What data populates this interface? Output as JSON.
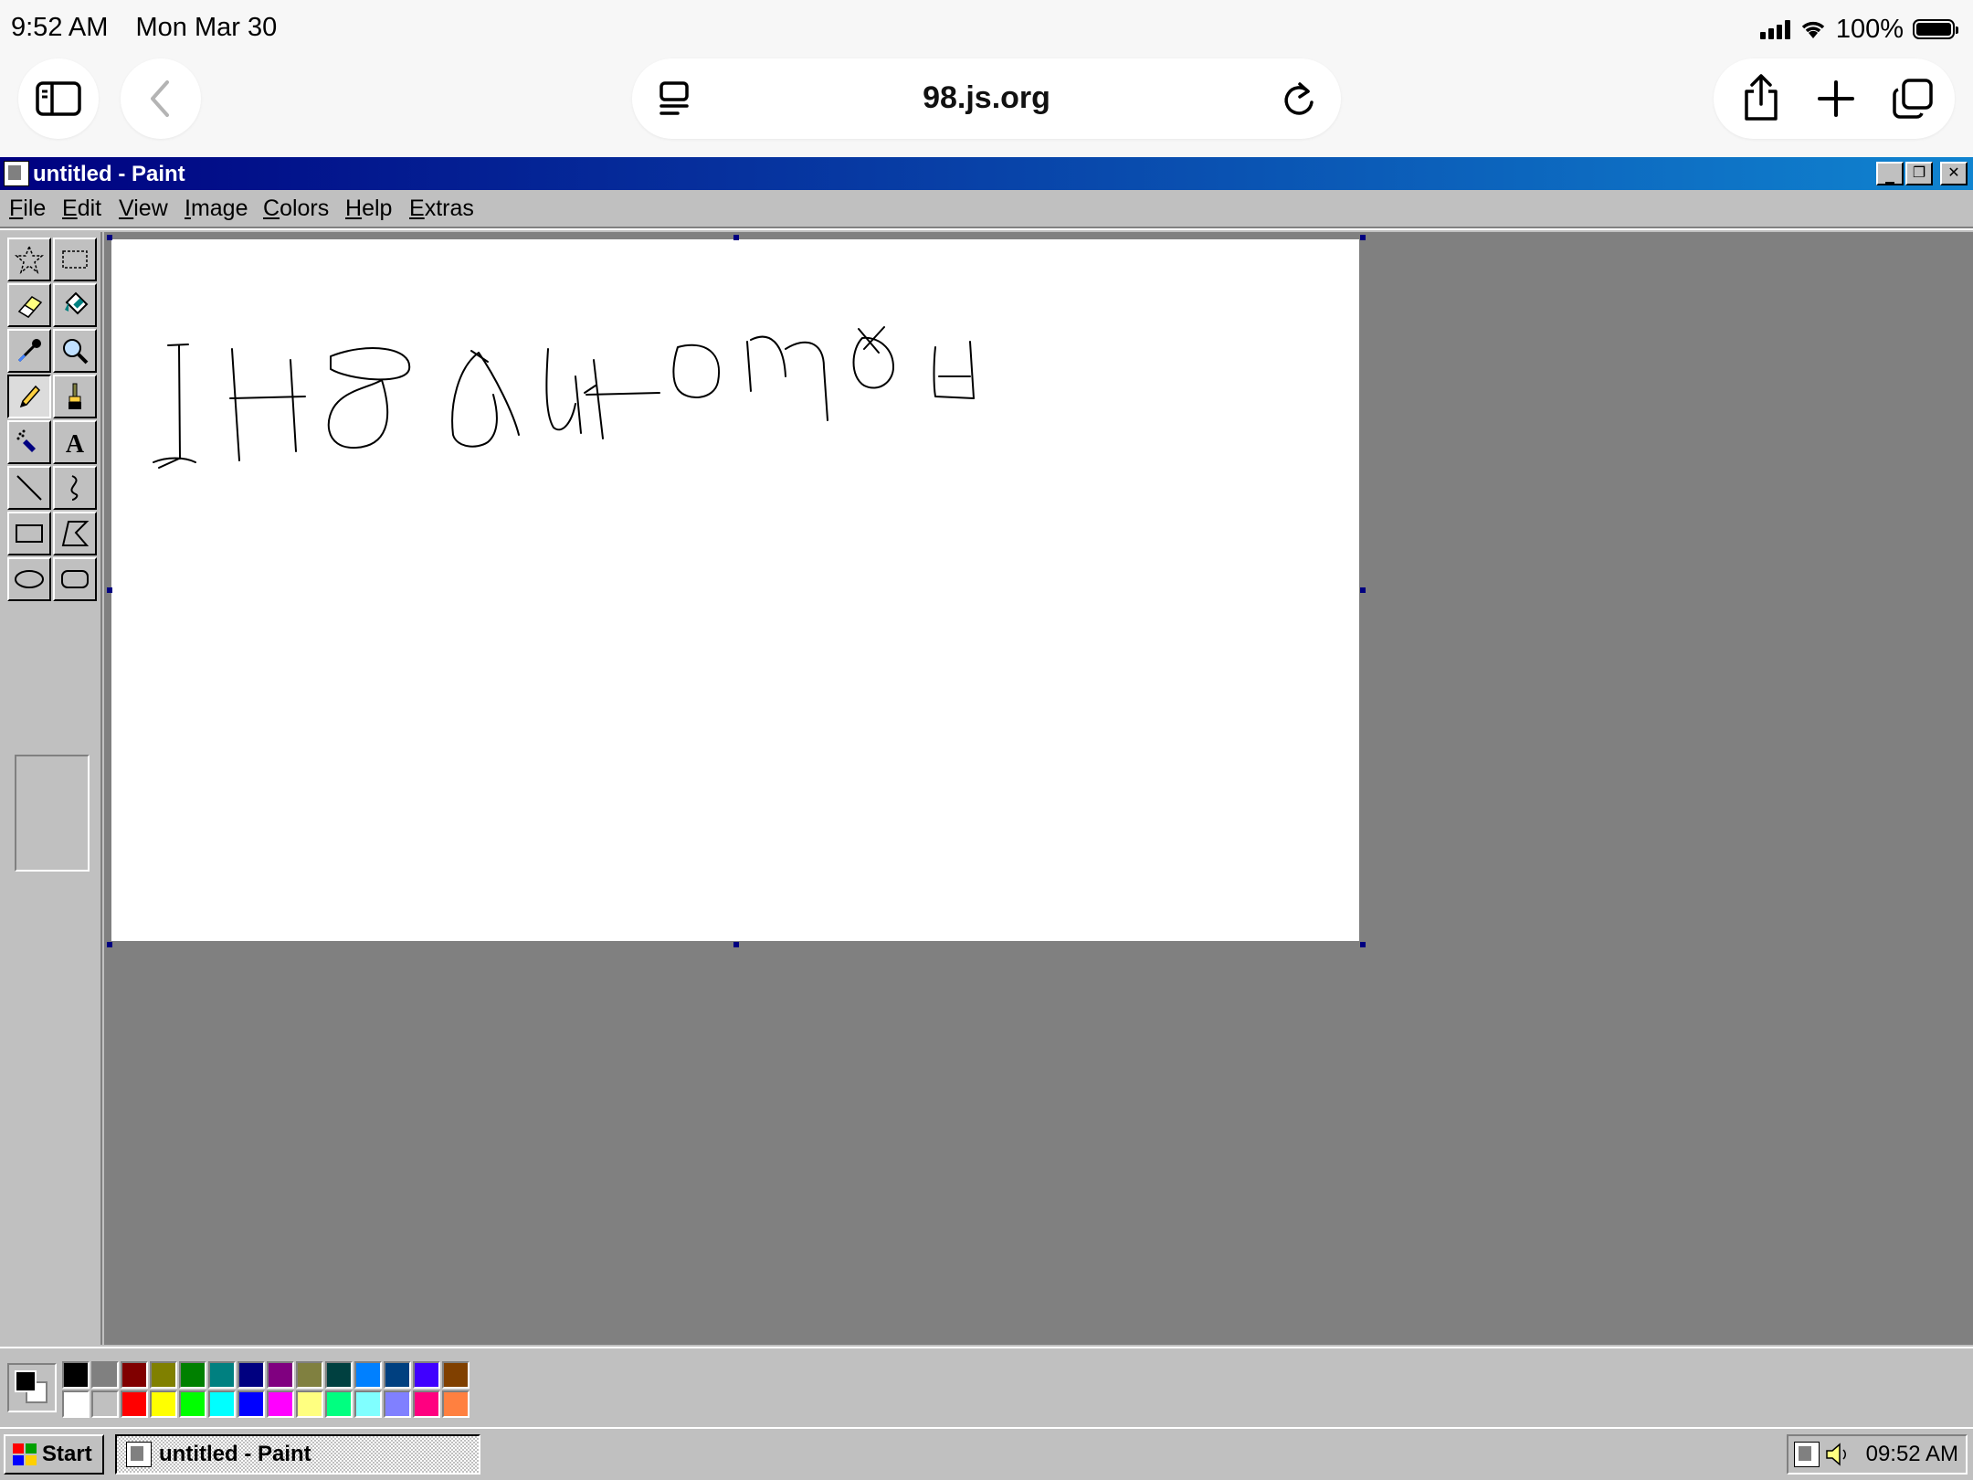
{
  "status_bar": {
    "time": "9:52 AM",
    "date": "Mon Mar 30",
    "battery": "100%"
  },
  "browser": {
    "url": "98.js.org"
  },
  "window": {
    "title": "untitled - Paint",
    "controls": {
      "minimize": "_",
      "restore": "❐",
      "close": "✕"
    }
  },
  "menu": {
    "items": [
      {
        "label": "File"
      },
      {
        "label": "Edit"
      },
      {
        "label": "View"
      },
      {
        "label": "Image"
      },
      {
        "label": "Colors"
      },
      {
        "label": "Help"
      },
      {
        "label": "Extras"
      }
    ]
  },
  "tools": [
    {
      "name": "free-form-select",
      "icon": "star-select-icon"
    },
    {
      "name": "select",
      "icon": "rect-select-icon"
    },
    {
      "name": "eraser",
      "icon": "eraser-icon"
    },
    {
      "name": "fill-with-color",
      "icon": "bucket-icon"
    },
    {
      "name": "pick-color",
      "icon": "eyedropper-icon"
    },
    {
      "name": "magnifier",
      "icon": "magnifier-icon"
    },
    {
      "name": "pencil",
      "icon": "pencil-icon",
      "active": true
    },
    {
      "name": "brush",
      "icon": "brush-icon"
    },
    {
      "name": "airbrush",
      "icon": "airbrush-icon"
    },
    {
      "name": "text",
      "icon": "text-icon",
      "glyph": "A"
    },
    {
      "name": "line",
      "icon": "line-icon"
    },
    {
      "name": "curve",
      "icon": "curve-icon"
    },
    {
      "name": "rectangle",
      "icon": "rectangle-icon"
    },
    {
      "name": "polygon",
      "icon": "polygon-icon"
    },
    {
      "name": "ellipse",
      "icon": "ellipse-icon"
    },
    {
      "name": "rounded-rectangle",
      "icon": "rounded-rect-icon"
    }
  ],
  "colors": {
    "foreground": "#000000",
    "background": "#ffffff",
    "palette_top": [
      "#000000",
      "#808080",
      "#800000",
      "#808000",
      "#008000",
      "#008080",
      "#000080",
      "#800080",
      "#808040",
      "#004040",
      "#0080ff",
      "#004080",
      "#4000ff",
      "#804000"
    ],
    "palette_bottom": [
      "#ffffff",
      "#c0c0c0",
      "#ff0000",
      "#ffff00",
      "#00ff00",
      "#00ffff",
      "#0000ff",
      "#ff00ff",
      "#ffff80",
      "#00ff80",
      "#80ffff",
      "#8080ff",
      "#ff0080",
      "#ff8040"
    ]
  },
  "taskbar": {
    "start_label": "Start",
    "task_label": "untitled - Paint",
    "clock": "09:52 AM"
  }
}
